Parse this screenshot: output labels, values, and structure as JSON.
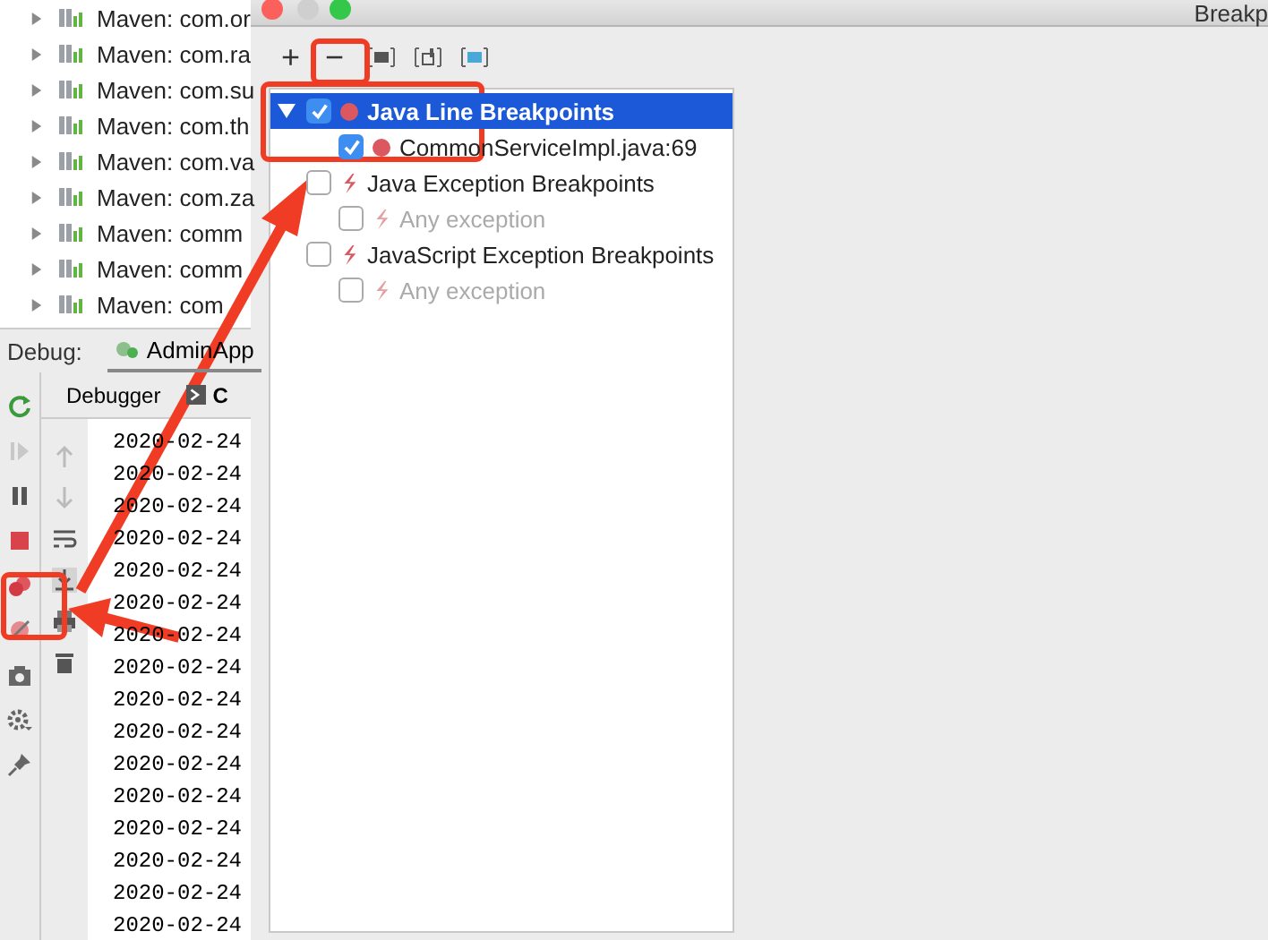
{
  "project_tree": {
    "items": [
      {
        "label": "Maven: com.or"
      },
      {
        "label": "Maven: com.ra"
      },
      {
        "label": "Maven: com.su"
      },
      {
        "label": "Maven: com.th"
      },
      {
        "label": "Maven: com.va"
      },
      {
        "label": "Maven: com.za"
      },
      {
        "label": "Maven: comm"
      },
      {
        "label": "Maven: comm"
      },
      {
        "label": "Maven: com"
      }
    ]
  },
  "debug_bar": {
    "label": "Debug:",
    "session_tab": {
      "label": "AdminApp",
      "selected": true
    }
  },
  "debug_tabs": [
    {
      "label": "Debugger",
      "selected": false
    },
    {
      "label": "C",
      "selected": true
    }
  ],
  "console_lines": [
    "2020-02-24",
    "2020-02-24",
    "2020-02-24",
    "2020-02-24",
    "2020-02-24",
    "2020-02-24",
    "2020-02-24",
    "2020-02-24",
    "2020-02-24",
    "2020-02-24",
    "2020-02-24",
    "2020-02-24",
    "2020-02-24",
    "2020-02-24",
    "2020-02-24",
    "2020-02-24"
  ],
  "dialog": {
    "title": "Breakp",
    "toolbar_buttons": [
      "+",
      "−"
    ],
    "tree": [
      {
        "label": "Java Line Breakpoints",
        "kind": "line",
        "checked": true,
        "selected": true,
        "expanded": true,
        "disabled": false,
        "children": [
          {
            "label": "CommonServiceImpl.java:69",
            "kind": "line",
            "checked": true,
            "selected": false,
            "disabled": false
          }
        ]
      },
      {
        "label": "Java Exception Breakpoints",
        "kind": "exception",
        "checked": false,
        "selected": false,
        "disabled": false,
        "children": [
          {
            "label": "Any exception",
            "kind": "exception",
            "checked": false,
            "selected": false,
            "disabled": true
          }
        ]
      },
      {
        "label": "JavaScript Exception Breakpoints",
        "kind": "exception",
        "checked": false,
        "selected": false,
        "disabled": false,
        "children": [
          {
            "label": "Any exception",
            "kind": "exception",
            "checked": false,
            "selected": false,
            "disabled": true
          }
        ]
      }
    ]
  }
}
